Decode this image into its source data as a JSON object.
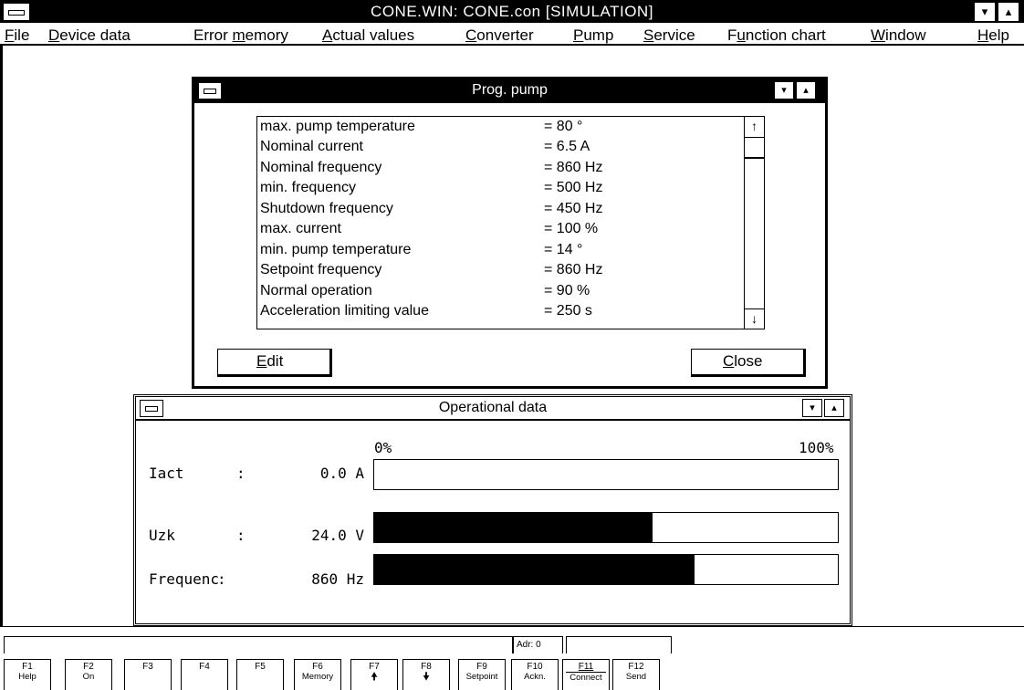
{
  "app": {
    "title": "CONE.WIN: CONE.con [SIMULATION]",
    "minimize_glyph": "▾",
    "maximize_glyph": "▴"
  },
  "menu": [
    {
      "pre": "",
      "u": "F",
      "post": "ile"
    },
    {
      "pre": "",
      "u": "D",
      "post": "evice data"
    },
    {
      "pre": "Error ",
      "u": "m",
      "post": "emory"
    },
    {
      "pre": "",
      "u": "A",
      "post": "ctual values"
    },
    {
      "pre": "",
      "u": "C",
      "post": "onverter"
    },
    {
      "pre": "",
      "u": "P",
      "post": "ump"
    },
    {
      "pre": "",
      "u": "S",
      "post": "ervice"
    },
    {
      "pre": "F",
      "u": "u",
      "post": "nction chart"
    },
    {
      "pre": "",
      "u": "W",
      "post": "indow"
    },
    {
      "pre": "",
      "u": "H",
      "post": "elp"
    }
  ],
  "prog_pump": {
    "title": "Prog. pump",
    "params": [
      {
        "name": "max. pump temperature",
        "value": "= 80 °"
      },
      {
        "name": "Nominal current",
        "value": "= 6.5 A"
      },
      {
        "name": "Nominal frequency",
        "value": "= 860 Hz"
      },
      {
        "name": "min. frequency",
        "value": "= 500 Hz"
      },
      {
        "name": "Shutdown frequency",
        "value": "= 450 Hz"
      },
      {
        "name": "max. current",
        "value": "= 100 %"
      },
      {
        "name": "min. pump temperature",
        "value": "= 14 °"
      },
      {
        "name": "Setpoint frequency",
        "value": "= 860 Hz"
      },
      {
        "name": "Normal operation",
        "value": "= 90 %"
      },
      {
        "name": "Acceleration limiting value",
        "value": "= 250 s"
      }
    ],
    "scroll_up_glyph": "↑",
    "scroll_down_glyph": "↓",
    "edit_button": {
      "u": "E",
      "post": "dit"
    },
    "close_button": {
      "u": "C",
      "post": "lose"
    }
  },
  "operational_data": {
    "title": "Operational data",
    "scale_min": "0%",
    "scale_max": "100%",
    "rows": [
      {
        "label": "Iact",
        "sep": ":",
        "value": "0.0 A",
        "fraction": 0.0
      },
      {
        "label": "Uzk",
        "sep": ":",
        "value": "24.0 V",
        "fraction": 0.6
      },
      {
        "label": "Frequenc",
        "sep": ":",
        "value": "860 Hz",
        "fraction": 0.69
      }
    ]
  },
  "status": {
    "address": "Adr: 0"
  },
  "function_keys": [
    {
      "key": "F1",
      "label": "Help"
    },
    {
      "key": "F2",
      "label": "On"
    },
    {
      "key": "F3",
      "label": ""
    },
    {
      "key": "F4",
      "label": ""
    },
    {
      "key": "F5",
      "label": ""
    },
    {
      "key": "F6",
      "label": "Memory"
    },
    {
      "key": "F7",
      "label": "🠝"
    },
    {
      "key": "F8",
      "label": "🠟"
    },
    {
      "key": "F9",
      "label": "Setpoint"
    },
    {
      "key": "F10",
      "label": "Ackn."
    },
    {
      "key": "F11",
      "label": "Connect"
    },
    {
      "key": "F12",
      "label": "Send"
    }
  ]
}
